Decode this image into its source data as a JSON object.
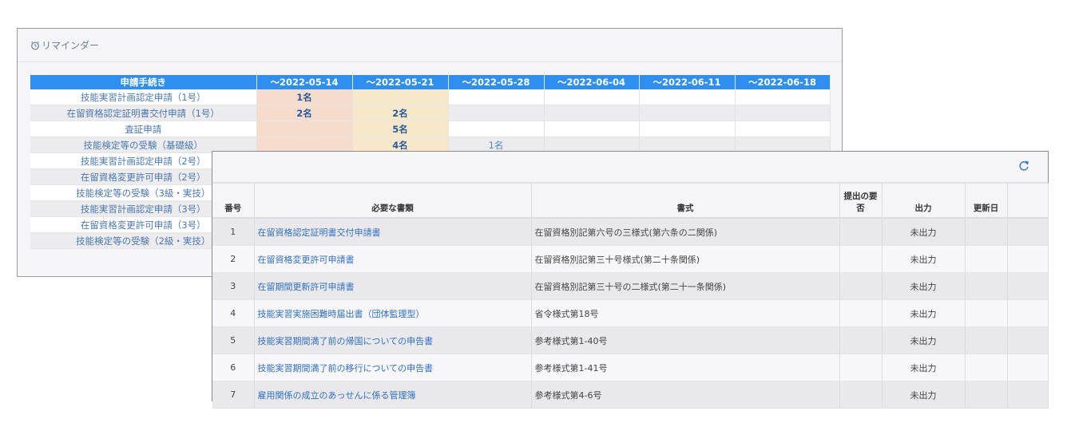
{
  "reminder": {
    "title": "リマインダー",
    "columns": [
      "申請手続き",
      "～2022-05-14",
      "～2022-05-21",
      "～2022-05-28",
      "～2022-06-04",
      "～2022-06-11",
      "～2022-06-18"
    ],
    "rows": [
      {
        "procedure": "技能実習計画認定申請（1号）",
        "cells": [
          "1名",
          "",
          "",
          "",
          "",
          ""
        ]
      },
      {
        "procedure": "在留資格認定証明書交付申請（1号）",
        "cells": [
          "2名",
          "2名",
          "",
          "",
          "",
          ""
        ]
      },
      {
        "procedure": "査証申請",
        "cells": [
          "",
          "5名",
          "",
          "",
          "",
          ""
        ]
      },
      {
        "procedure": "技能検定等の受験（基礎級）",
        "cells": [
          "",
          "4名",
          "1名",
          "",
          "",
          ""
        ]
      },
      {
        "procedure": "技能実習計画認定申請（2号）",
        "cells": [
          "",
          "",
          "",
          "",
          "",
          ""
        ]
      },
      {
        "procedure": "在留資格変更許可申請（2号）",
        "cells": [
          "",
          "",
          "",
          "",
          "",
          ""
        ]
      },
      {
        "procedure": "技能検定等の受験（3級・実技）",
        "cells": [
          "",
          "",
          "",
          "",
          "",
          ""
        ]
      },
      {
        "procedure": "技能実習計画認定申請（3号）",
        "cells": [
          "",
          "",
          "",
          "",
          "",
          ""
        ]
      },
      {
        "procedure": "在留資格変更許可申請（3号）",
        "cells": [
          "",
          "",
          "",
          "",
          "",
          ""
        ]
      },
      {
        "procedure": "技能検定等の受験（2級・実技）",
        "cells": [
          "",
          "",
          "",
          "",
          "",
          ""
        ]
      }
    ]
  },
  "documents": {
    "columns": [
      "番号",
      "必要な書類",
      "書式",
      "提出の要否",
      "出力",
      "更新日",
      ""
    ],
    "rows": [
      {
        "no": "1",
        "name": "在留資格認定証明書交付申請書",
        "format": "在留資格別記第六号の三様式(第六条の二関係)",
        "required": "",
        "output": "未出力",
        "updated": ""
      },
      {
        "no": "2",
        "name": "在留資格変更許可申請書",
        "format": "在留資格別記第三十号様式(第二十条関係)",
        "required": "",
        "output": "未出力",
        "updated": ""
      },
      {
        "no": "3",
        "name": "在留期間更新許可申請書",
        "format": "在留資格別記第三十号の二様式(第二十一条関係)",
        "required": "",
        "output": "未出力",
        "updated": ""
      },
      {
        "no": "4",
        "name": "技能実習実施困難時届出書（団体監理型）",
        "format": "省令様式第18号",
        "required": "",
        "output": "未出力",
        "updated": ""
      },
      {
        "no": "5",
        "name": "技能実習期間満了前の帰国についての申告書",
        "format": "参考様式第1-40号",
        "required": "",
        "output": "未出力",
        "updated": ""
      },
      {
        "no": "6",
        "name": "技能実習期間満了前の移行についての申告書",
        "format": "参考様式第1-41号",
        "required": "",
        "output": "未出力",
        "updated": ""
      },
      {
        "no": "7",
        "name": "雇用関係の成立のあっせんに係る管理簿",
        "format": "参考様式第4-6号",
        "required": "",
        "output": "未出力",
        "updated": ""
      }
    ]
  }
}
